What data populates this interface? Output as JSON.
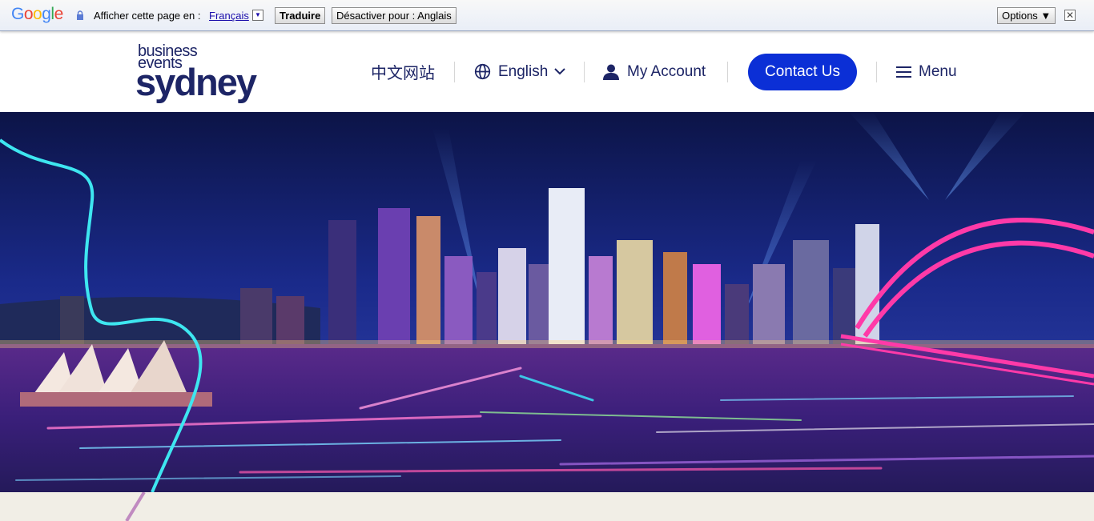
{
  "translate_bar": {
    "logo": [
      "G",
      "o",
      "o",
      "g",
      "l",
      "e"
    ],
    "logo_colors": [
      "#4285f4",
      "#ea4335",
      "#fbbc05",
      "#4285f4",
      "#34a853",
      "#ea4335"
    ],
    "prompt": "Afficher cette page en :",
    "language": "Français",
    "translate_button": "Traduire",
    "disable_button": "Désactiver pour : Anglais",
    "options_button": "Options ▼",
    "close_symbol": "✕"
  },
  "header": {
    "logo": {
      "line1": "business",
      "line2": "events",
      "line3": "sydney"
    },
    "nav": {
      "chinese_site": "中文网站",
      "language": "English",
      "account": "My Account",
      "contact": "Contact Us",
      "menu": "Menu"
    },
    "colors": {
      "navy": "#1d2566",
      "contact_bg": "#0b2fd6"
    }
  },
  "hero": {
    "image": "sydney-harbour-night-skyline-vivid-lights",
    "accent_line_color": "#3ee6f0"
  }
}
